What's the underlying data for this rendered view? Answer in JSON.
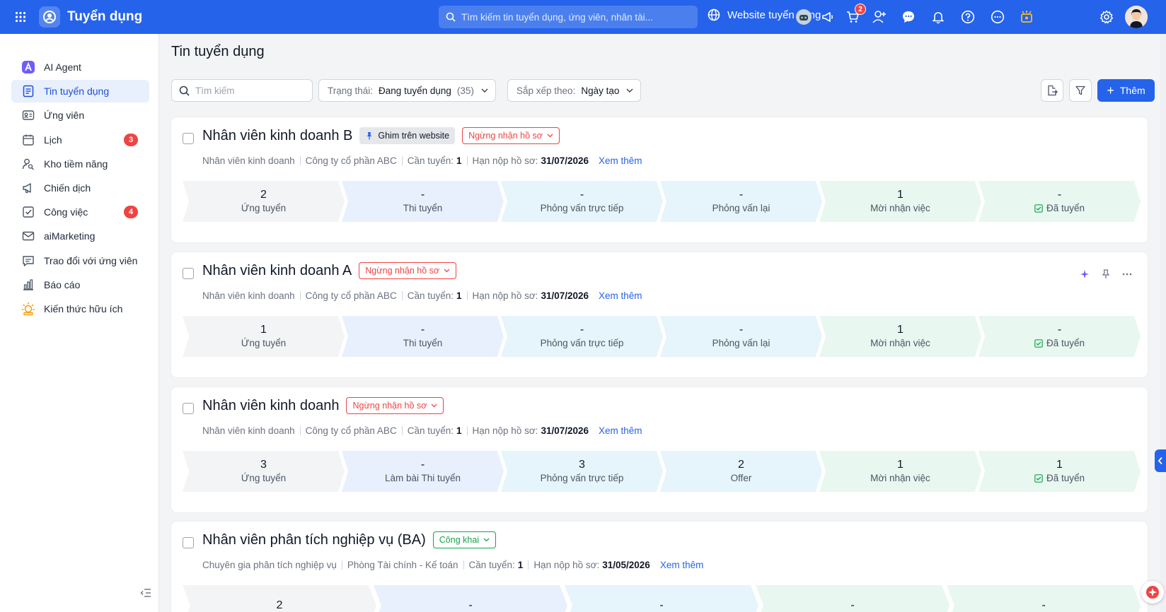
{
  "topbar": {
    "app_title": "Tuyển dụng",
    "search_placeholder": "Tìm kiếm tin tuyển dụng, ứng viên, nhân tài...",
    "website_link": "Website tuyển dụng",
    "cart_badge": "2"
  },
  "sidebar": {
    "items": [
      {
        "label": "AI Agent",
        "icon": "ai-agent-icon"
      },
      {
        "label": "Tin tuyển dụng",
        "icon": "document-icon",
        "active": true
      },
      {
        "label": "Ứng viên",
        "icon": "id-card-icon"
      },
      {
        "label": "Lịch",
        "icon": "calendar-icon",
        "badge": "3"
      },
      {
        "label": "Kho tiềm năng",
        "icon": "person-search-icon"
      },
      {
        "label": "Chiến dịch",
        "icon": "megaphone-icon"
      },
      {
        "label": "Công việc",
        "icon": "task-check-icon",
        "badge": "4"
      },
      {
        "label": "aiMarketing",
        "icon": "mail-icon"
      },
      {
        "label": "Trao đổi với ứng viên",
        "icon": "chat-icon"
      },
      {
        "label": "Báo cáo",
        "icon": "bar-chart-icon"
      },
      {
        "label": "Kiến thức hữu ích",
        "icon": "lightbulb-icon"
      }
    ]
  },
  "main": {
    "title": "Tin tuyển dụng",
    "search_placeholder": "Tìm kiếm",
    "status_filter": {
      "label": "Trạng thái:",
      "value": "Đang tuyển dụng",
      "count": "(35)"
    },
    "sort_filter": {
      "label": "Sắp xếp theo:",
      "value": "Ngày tạo"
    },
    "add_label": "Thêm"
  },
  "jobs": [
    {
      "title": "Nhân viên kinh doanh B",
      "pin_tag": "Ghim trên website",
      "status_tag": "Ngừng nhận hồ sơ",
      "status_kind": "stop",
      "position": "Nhân viên kinh doanh",
      "department": "Công ty cổ phần ABC",
      "need_label": "Cần tuyển:",
      "need_value": "1",
      "deadline_label": "Hạn nộp hồ sơ:",
      "deadline_value": "31/07/2026",
      "more": "Xem thêm",
      "stages": [
        {
          "num": "2",
          "name": "Ứng tuyển"
        },
        {
          "num": "-",
          "name": "Thi tuyển"
        },
        {
          "num": "-",
          "name": "Phỏng vấn trực tiếp"
        },
        {
          "num": "-",
          "name": "Phỏng vấn lại"
        },
        {
          "num": "1",
          "name": "Mời nhận việc"
        },
        {
          "num": "-",
          "name": "Đã tuyển"
        }
      ]
    },
    {
      "title": "Nhân viên kinh doanh A",
      "status_tag": "Ngừng nhận hồ sơ",
      "status_kind": "stop",
      "position": "Nhân viên kinh doanh",
      "department": "Công ty cổ phần ABC",
      "need_label": "Cần tuyển:",
      "need_value": "1",
      "deadline_label": "Hạn nộp hồ sơ:",
      "deadline_value": "31/07/2026",
      "more": "Xem thêm",
      "stages": [
        {
          "num": "1",
          "name": "Ứng tuyển"
        },
        {
          "num": "-",
          "name": "Thi tuyển"
        },
        {
          "num": "-",
          "name": "Phỏng vấn trực tiếp"
        },
        {
          "num": "-",
          "name": "Phỏng vấn lại"
        },
        {
          "num": "1",
          "name": "Mời nhận việc"
        },
        {
          "num": "-",
          "name": "Đã tuyển"
        }
      ]
    },
    {
      "title": "Nhân viên kinh doanh",
      "status_tag": "Ngừng nhận hồ sơ",
      "status_kind": "stop",
      "position": "Nhân viên kinh doanh",
      "department": "Công ty cổ phần ABC",
      "need_label": "Cần tuyển:",
      "need_value": "1",
      "deadline_label": "Hạn nộp hồ sơ:",
      "deadline_value": "31/07/2026",
      "more": "Xem thêm",
      "stages": [
        {
          "num": "3",
          "name": "Ứng tuyển"
        },
        {
          "num": "-",
          "name": "Làm bài Thi tuyển"
        },
        {
          "num": "3",
          "name": "Phỏng vấn trực tiếp"
        },
        {
          "num": "2",
          "name": "Offer"
        },
        {
          "num": "1",
          "name": "Mời nhận việc"
        },
        {
          "num": "1",
          "name": "Đã tuyển"
        }
      ]
    },
    {
      "title": "Nhân viên phân tích nghiệp vụ (BA)",
      "status_tag": "Công khai",
      "status_kind": "public",
      "position": "Chuyên gia phân tích nghiệp vụ",
      "department": "Phòng Tài chính - Kế toán",
      "need_label": "Cần tuyển:",
      "need_value": "1",
      "deadline_label": "Hạn nộp hồ sơ:",
      "deadline_value": "31/05/2026",
      "more": "Xem thêm",
      "stages": [
        {
          "num": "2",
          "name": ""
        },
        {
          "num": "-",
          "name": ""
        },
        {
          "num": "-",
          "name": ""
        },
        {
          "num": "-",
          "name": ""
        },
        {
          "num": "-",
          "name": ""
        }
      ]
    }
  ],
  "colors": {
    "primary": "#2563eb",
    "danger": "#ef4444",
    "success": "#16a34a",
    "stage_gray": "#f3f4f6",
    "stage_blue": "#e8f0fd",
    "stage_sky": "#e6f4fb",
    "stage_green": "#e8f7f0"
  }
}
